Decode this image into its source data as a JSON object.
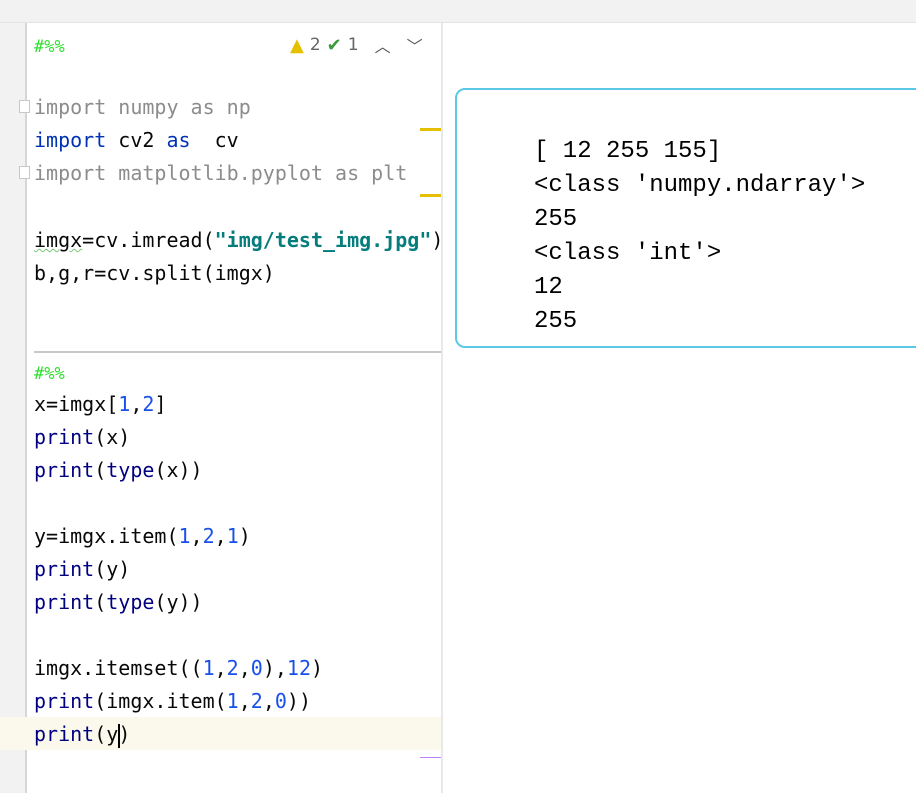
{
  "inspection": {
    "warnings": "2",
    "weak_warnings": "1",
    "icons": [
      "warning-triangle-icon",
      "check-icon",
      "chevron-up-icon",
      "chevron-down-icon"
    ]
  },
  "colors": {
    "comment": "#2ee02e",
    "keyword": "#0033b3",
    "string": "#067d7d",
    "number": "#1750eb",
    "builtin": "#000080",
    "output_border": "#5bc8e6"
  },
  "code": {
    "cell1": [
      {
        "tokens": [
          [
            "#%%",
            "c"
          ]
        ]
      },
      {
        "tokens": [
          [
            "import numpy as np",
            "g"
          ]
        ]
      },
      {
        "tokens": [
          [
            "import",
            "k"
          ],
          [
            " cv2 ",
            ""
          ],
          [
            "as",
            "k"
          ],
          [
            "  cv",
            ""
          ]
        ]
      },
      {
        "tokens": [
          [
            "import matplotlib.pyplot as plt",
            "g"
          ]
        ]
      },
      {
        "tokens": [
          [
            "imgx",
            "wavy"
          ],
          [
            "=cv.imread(",
            ""
          ],
          [
            "\"img/test_img.jpg\"",
            "s"
          ],
          [
            ")",
            ""
          ]
        ]
      },
      {
        "tokens": [
          [
            "b,g,r=cv.split(imgx)",
            ""
          ]
        ]
      }
    ],
    "cell2": [
      {
        "tokens": [
          [
            "#%%",
            "c"
          ]
        ]
      },
      {
        "tokens": [
          [
            "x=imgx[",
            ""
          ],
          [
            "1",
            "num"
          ],
          [
            ",",
            ""
          ],
          [
            "2",
            "num"
          ],
          [
            "]",
            ""
          ]
        ]
      },
      {
        "tokens": [
          [
            "print",
            "f"
          ],
          [
            "(x)",
            ""
          ]
        ]
      },
      {
        "tokens": [
          [
            "print",
            "f"
          ],
          [
            "(",
            ""
          ],
          [
            "type",
            "f"
          ],
          [
            "(x))",
            ""
          ]
        ]
      },
      {
        "tokens": [
          [
            "y=imgx.item(",
            ""
          ],
          [
            "1",
            "num"
          ],
          [
            ",",
            ""
          ],
          [
            "2",
            "num"
          ],
          [
            ",",
            ""
          ],
          [
            "1",
            "num"
          ],
          [
            ")",
            ""
          ]
        ]
      },
      {
        "tokens": [
          [
            "print",
            "f"
          ],
          [
            "(y)",
            ""
          ]
        ]
      },
      {
        "tokens": [
          [
            "print",
            "f"
          ],
          [
            "(",
            ""
          ],
          [
            "type",
            "f"
          ],
          [
            "(y))",
            ""
          ]
        ]
      },
      {
        "tokens": [
          [
            "imgx.itemset((",
            ""
          ],
          [
            "1",
            "num"
          ],
          [
            ",",
            ""
          ],
          [
            "2",
            "num"
          ],
          [
            ",",
            ""
          ],
          [
            "0",
            "num"
          ],
          [
            "),",
            ""
          ],
          [
            "12",
            "num"
          ],
          [
            ")",
            ""
          ]
        ]
      },
      {
        "tokens": [
          [
            "print",
            "f"
          ],
          [
            "(imgx.item(",
            ""
          ],
          [
            "1",
            "num"
          ],
          [
            ",",
            ""
          ],
          [
            "2",
            "num"
          ],
          [
            ",",
            ""
          ],
          [
            "0",
            "num"
          ],
          [
            "))",
            ""
          ]
        ]
      },
      {
        "tokens": [
          [
            "print",
            "f"
          ],
          [
            "(y",
            ""
          ],
          [
            "|caret",
            ""
          ],
          [
            ")",
            ""
          ]
        ]
      }
    ]
  },
  "output": {
    "lines": [
      "[ 12 255 155]",
      "<class 'numpy.ndarray'>",
      "255",
      "<class 'int'>",
      "12",
      "255"
    ]
  }
}
